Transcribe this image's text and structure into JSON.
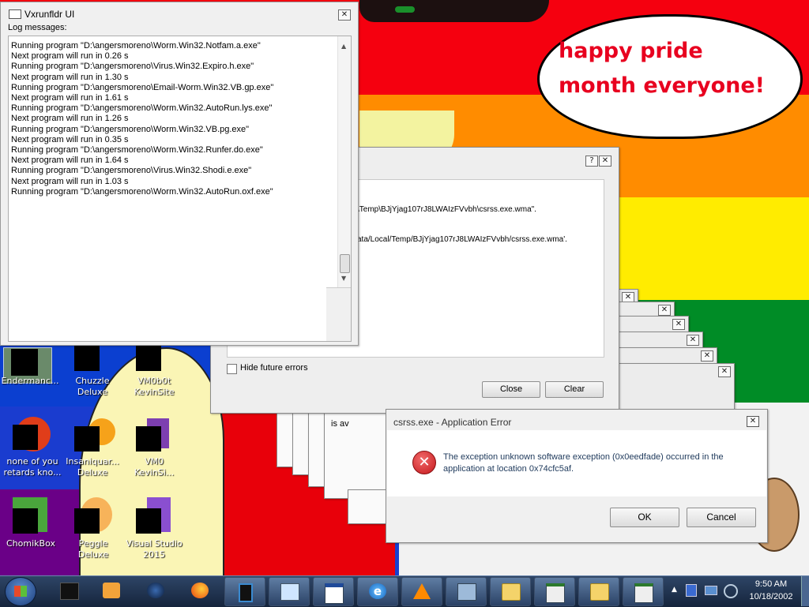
{
  "desktop": {
    "speech_bubble": "happy pride month everyone!",
    "icons": [
      {
        "label": "Endermanc..."
      },
      {
        "label": "Chuzzle Deluxe"
      },
      {
        "label": "VM0b0t KevinSite"
      },
      {
        "label": "none of you retards kno..."
      },
      {
        "label": "Insaniquar... Deluxe"
      },
      {
        "label": "VM0 KevinSi..."
      },
      {
        "label": "ChomikBox"
      },
      {
        "label": "Peggle Deluxe"
      },
      {
        "label": "Visual Studio 2015"
      }
    ]
  },
  "log_window": {
    "title": "Vxrunfldr UI",
    "label": "Log messages:",
    "lines": [
      "Running program \"D:\\angersmoreno\\Worm.Win32.Notfam.a.exe\"",
      "Next program will run in 0.26 s",
      "Running program \"D:\\angersmoreno\\Virus.Win32.Expiro.h.exe\"",
      "Next program will run in 1.30 s",
      "Running program \"D:\\angersmoreno\\Email-Worm.Win32.VB.gp.exe\"",
      "Next program will run in 1.61 s",
      "Running program \"D:\\angersmoreno\\Worm.Win32.AutoRun.lys.exe\"",
      "Next program will run in 1.26 s",
      "Running program \"D:\\angersmoreno\\Worm.Win32.VB.pg.exe\"",
      "Next program will run in 0.35 s",
      "Running program \"D:\\angersmoreno\\Worm.Win32.Runfer.do.exe\"",
      "Next program will run in 1.64 s",
      "Running program \"D:\\angersmoreno\\Virus.Win32.Shodi.e.exe\"",
      "Next program will run in 1.03 s",
      "Running program \"D:\\angersmoreno\\Worm.Win32.AutoRun.oxf.exe\""
    ]
  },
  "error_list_window": {
    "line1": "\\Temp\\BJjYjag107rJ8LWAIzFVvbh\\csrss.exe.wma\".",
    "line2": "ata/Local/Temp/BJjYjag107rJ8LWAIzFVvbh/csrss.exe.wma'.",
    "hide_label": "Hide future errors",
    "close_label": "Close",
    "clear_label": "Clear"
  },
  "partial_window_text": "is av",
  "app_error": {
    "title": "csrss.exe - Application Error",
    "message": "The exception unknown software exception (0x0eedfade) occurred in the application at location 0x74cfc5af.",
    "ok_label": "OK",
    "cancel_label": "Cancel"
  },
  "taskbar": {
    "time": "9:50 AM",
    "date": "10/18/2002"
  },
  "colors": {
    "red": "#f8000c",
    "orange": "#ff8c00",
    "yellow": "#ffed00",
    "green": "#008c26",
    "blue": "#1840d0",
    "purple": "#75007f",
    "error_red": "#c4181c"
  }
}
